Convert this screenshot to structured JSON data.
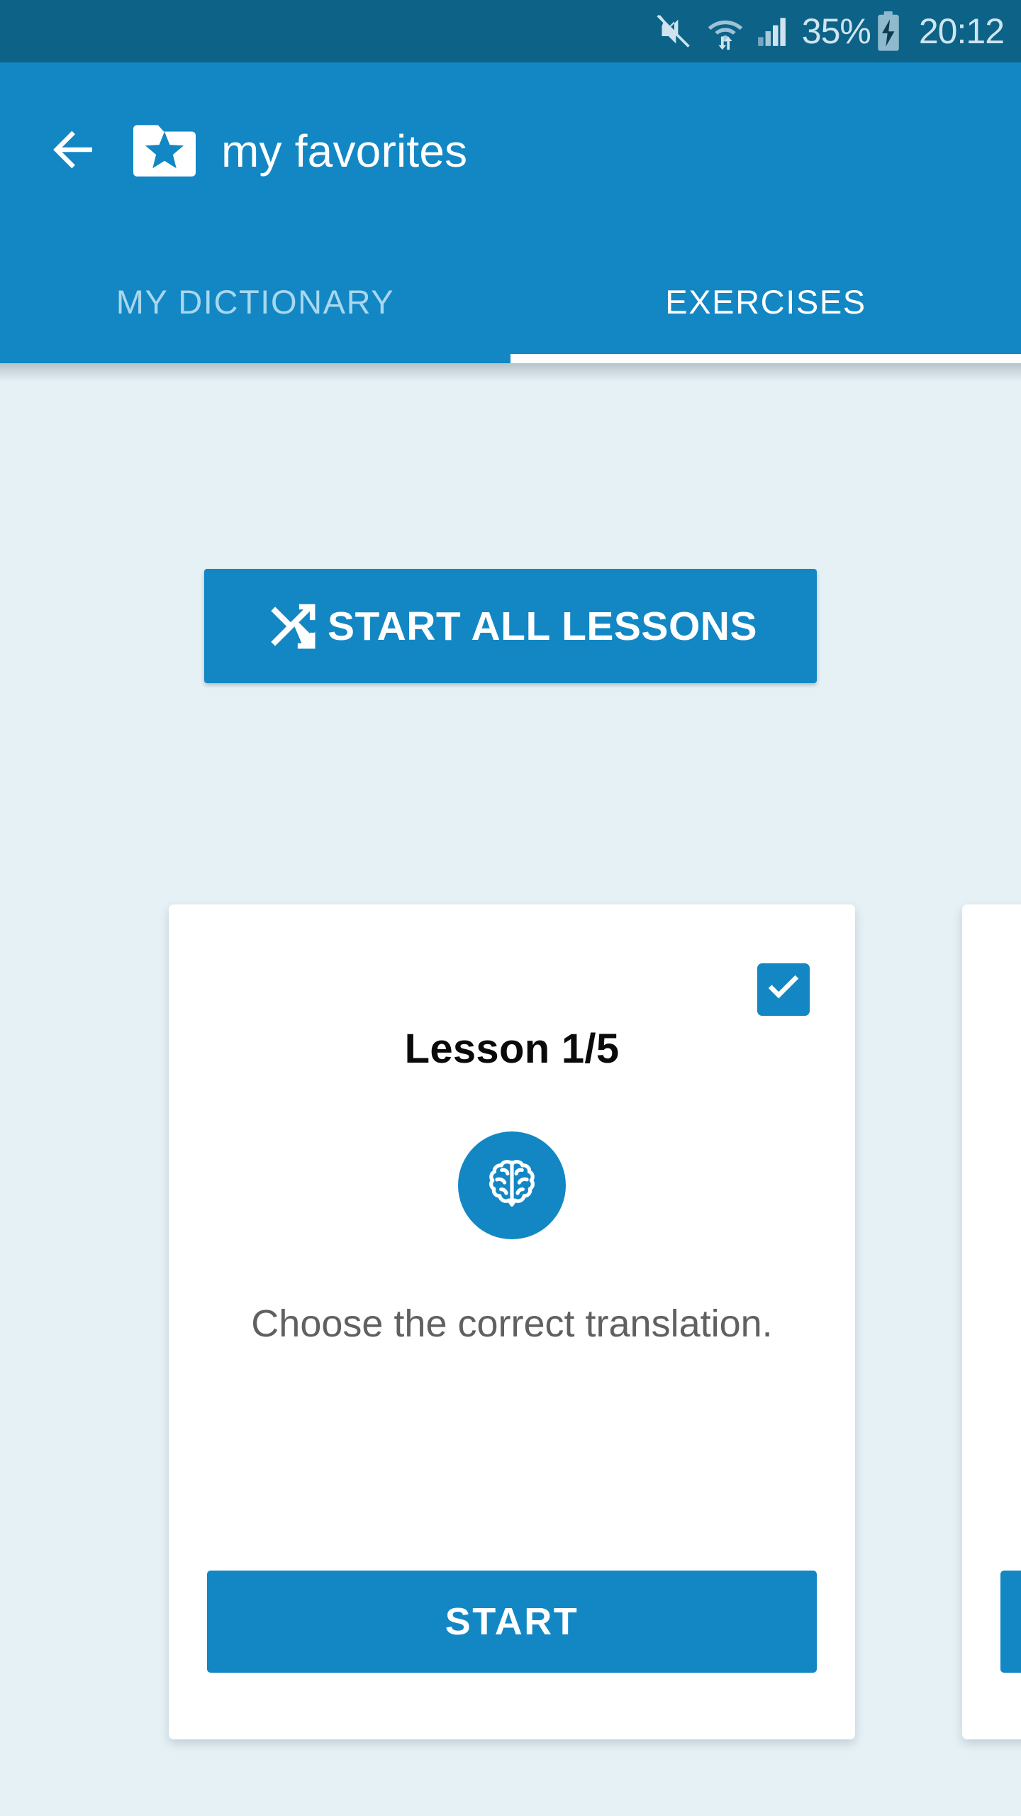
{
  "status_bar": {
    "background_color": "#0c6287",
    "text_color": "#cfe4ee",
    "icons": [
      "mute-icon",
      "wifi-icon",
      "signal-icon",
      "battery-charging-icon"
    ],
    "battery_percent": "35%",
    "clock": "20:12"
  },
  "app_bar": {
    "background_color": "#1287c4",
    "back_icon": "back-arrow-icon",
    "logo_icon": "folder-star-icon",
    "title": "my favorites"
  },
  "tabs": {
    "active_index": 1,
    "indicator_color": "#ffffff",
    "items": [
      {
        "label": "MY DICTIONARY",
        "active": false
      },
      {
        "label": "EXERCISES",
        "active": true
      }
    ]
  },
  "content": {
    "background_color": "#e6f1f6",
    "start_all_lessons": {
      "icon": "shuffle-icon",
      "label": "START ALL LESSONS",
      "color": "#1287c4"
    },
    "cards": [
      {
        "title": "Lesson 1/5",
        "icon": "brain-icon",
        "checkbox_checked": true,
        "checkbox_icon": "check-icon",
        "description": "Choose the correct translation.",
        "start_label": "START",
        "accent_color": "#1287c4"
      },
      {
        "title": "",
        "icon": "brain-icon",
        "checkbox_checked": false,
        "checkbox_icon": "check-icon",
        "description": "",
        "start_label": "",
        "accent_color": "#1287c4"
      }
    ]
  }
}
